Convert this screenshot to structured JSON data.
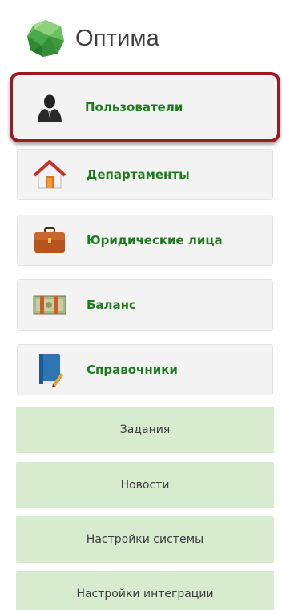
{
  "app": {
    "title": "Оптима",
    "logo_icon": "green-circle-logo-icon"
  },
  "nav": {
    "items": [
      {
        "label": "Пользователи",
        "icon": "user-icon",
        "active": true
      },
      {
        "label": "Департаменты",
        "icon": "house-icon",
        "active": false
      },
      {
        "label": "Юридические лица",
        "icon": "briefcase-icon",
        "active": false
      },
      {
        "label": "Баланс",
        "icon": "money-icon",
        "active": false
      },
      {
        "label": "Справочники",
        "icon": "book-icon",
        "active": false
      }
    ],
    "sub_items": [
      {
        "label": "Задания"
      },
      {
        "label": "Новости"
      },
      {
        "label": "Настройки системы"
      },
      {
        "label": "Настройки интеграции"
      }
    ]
  },
  "colors": {
    "active_border": "#9a1b22",
    "nav_label": "#1e7a1e",
    "sub_item_bg": "#d7ebcf"
  }
}
